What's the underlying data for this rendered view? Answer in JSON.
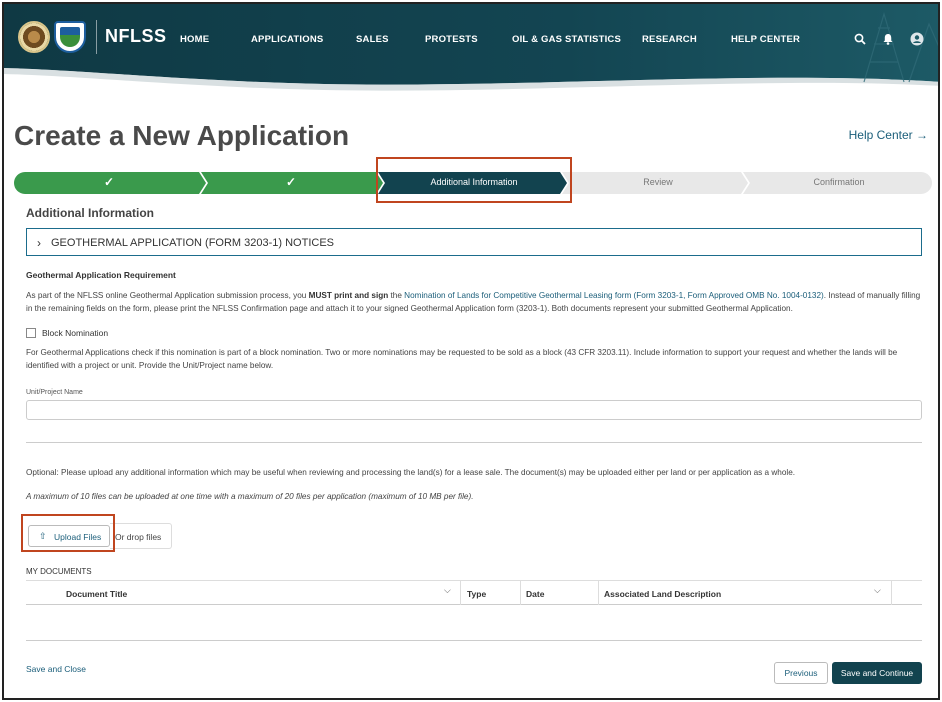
{
  "header": {
    "brand": "NFLSS",
    "nav": [
      "HOME",
      "APPLICATIONS",
      "SALES",
      "PROTESTS",
      "OIL & GAS STATISTICS",
      "RESEARCH",
      "HELP CENTER"
    ],
    "colors": {
      "header_dark": "#0e3a47",
      "header_light": "#1d5c6b",
      "accent": "#12434f"
    },
    "icons": [
      "search-icon",
      "bell-icon",
      "user-icon"
    ]
  },
  "page": {
    "title": "Create a New Application",
    "help_link": "Help Center →"
  },
  "stepper": {
    "steps": [
      {
        "label": "✓",
        "state": "complete"
      },
      {
        "label": "✓",
        "state": "complete"
      },
      {
        "label": "Additional Information",
        "state": "current"
      },
      {
        "label": "Review",
        "state": "upcoming"
      },
      {
        "label": "Confirmation",
        "state": "upcoming"
      }
    ],
    "colors": {
      "complete": "#3a9a4c",
      "current": "#12434f",
      "upcoming": "#e6e6e6"
    }
  },
  "section": {
    "title": "Additional Information",
    "accordion_label": "GEOTHERMAL APPLICATION (FORM 3203-1) NOTICES"
  },
  "requirement": {
    "heading": "Geothermal Application Requirement",
    "p1_a": "As part of the NFLSS online Geothermal Application submission process, you ",
    "p1_bold": "MUST print and sign",
    "p1_b": " the ",
    "p1_link": "Nomination of Lands for Competitive Geothermal Leasing form (Form 3203-1, Form Approved OMB No. 1004-0132)",
    "p1_c": ". Instead of manually filling in the remaining fields on the form, please print the NFLSS Confirmation page and attach it to your signed Geothermal Application form (3203-1). Both documents represent your submitted Geothermal Application."
  },
  "block": {
    "checkbox_label": "Block Nomination",
    "checked": false,
    "description": "For Geothermal Applications check if this nomination is part of a block nomination. Two or more nominations may be requested to be sold as a block (43 CFR 3203.11). Include information to support your request and whether the lands will be identified with a project or unit. Provide the Unit/Project name below.",
    "field_label": "Unit/Project Name",
    "field_value": ""
  },
  "upload": {
    "optional_text": "Optional: Please upload any additional information which may be useful when reviewing and processing the land(s) for a lease sale. The document(s) may be uploaded either per land or per application as a whole.",
    "limit_text": "A maximum of 10 files can be uploaded at one time with a maximum of 20 files per application (maximum of 10 MB per file).",
    "button_label": "Upload Files",
    "drop_label": "Or drop files"
  },
  "documents": {
    "label": "MY DOCUMENTS",
    "columns": [
      "Document Title",
      "Type",
      "Date",
      "Associated Land Description"
    ],
    "rows": []
  },
  "footer": {
    "save_close": "Save and Close",
    "previous": "Previous",
    "save_continue": "Save and Continue"
  }
}
